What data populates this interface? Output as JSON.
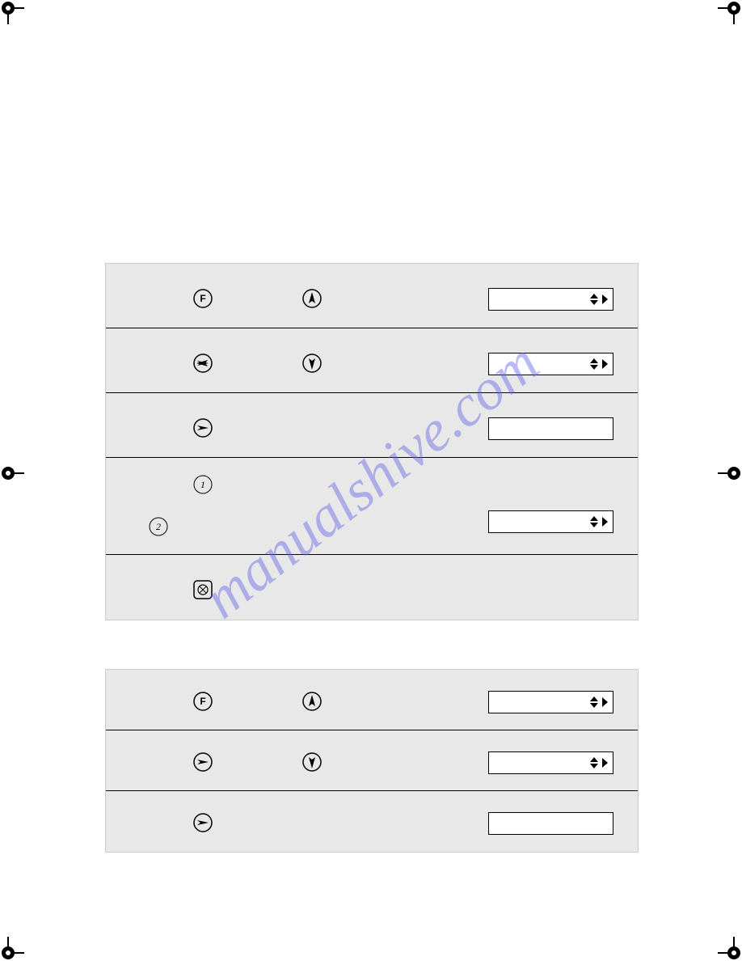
{
  "watermark": "manualshive.com",
  "icons": {
    "f_key": "F",
    "circle_one": "1",
    "circle_two": "2"
  }
}
